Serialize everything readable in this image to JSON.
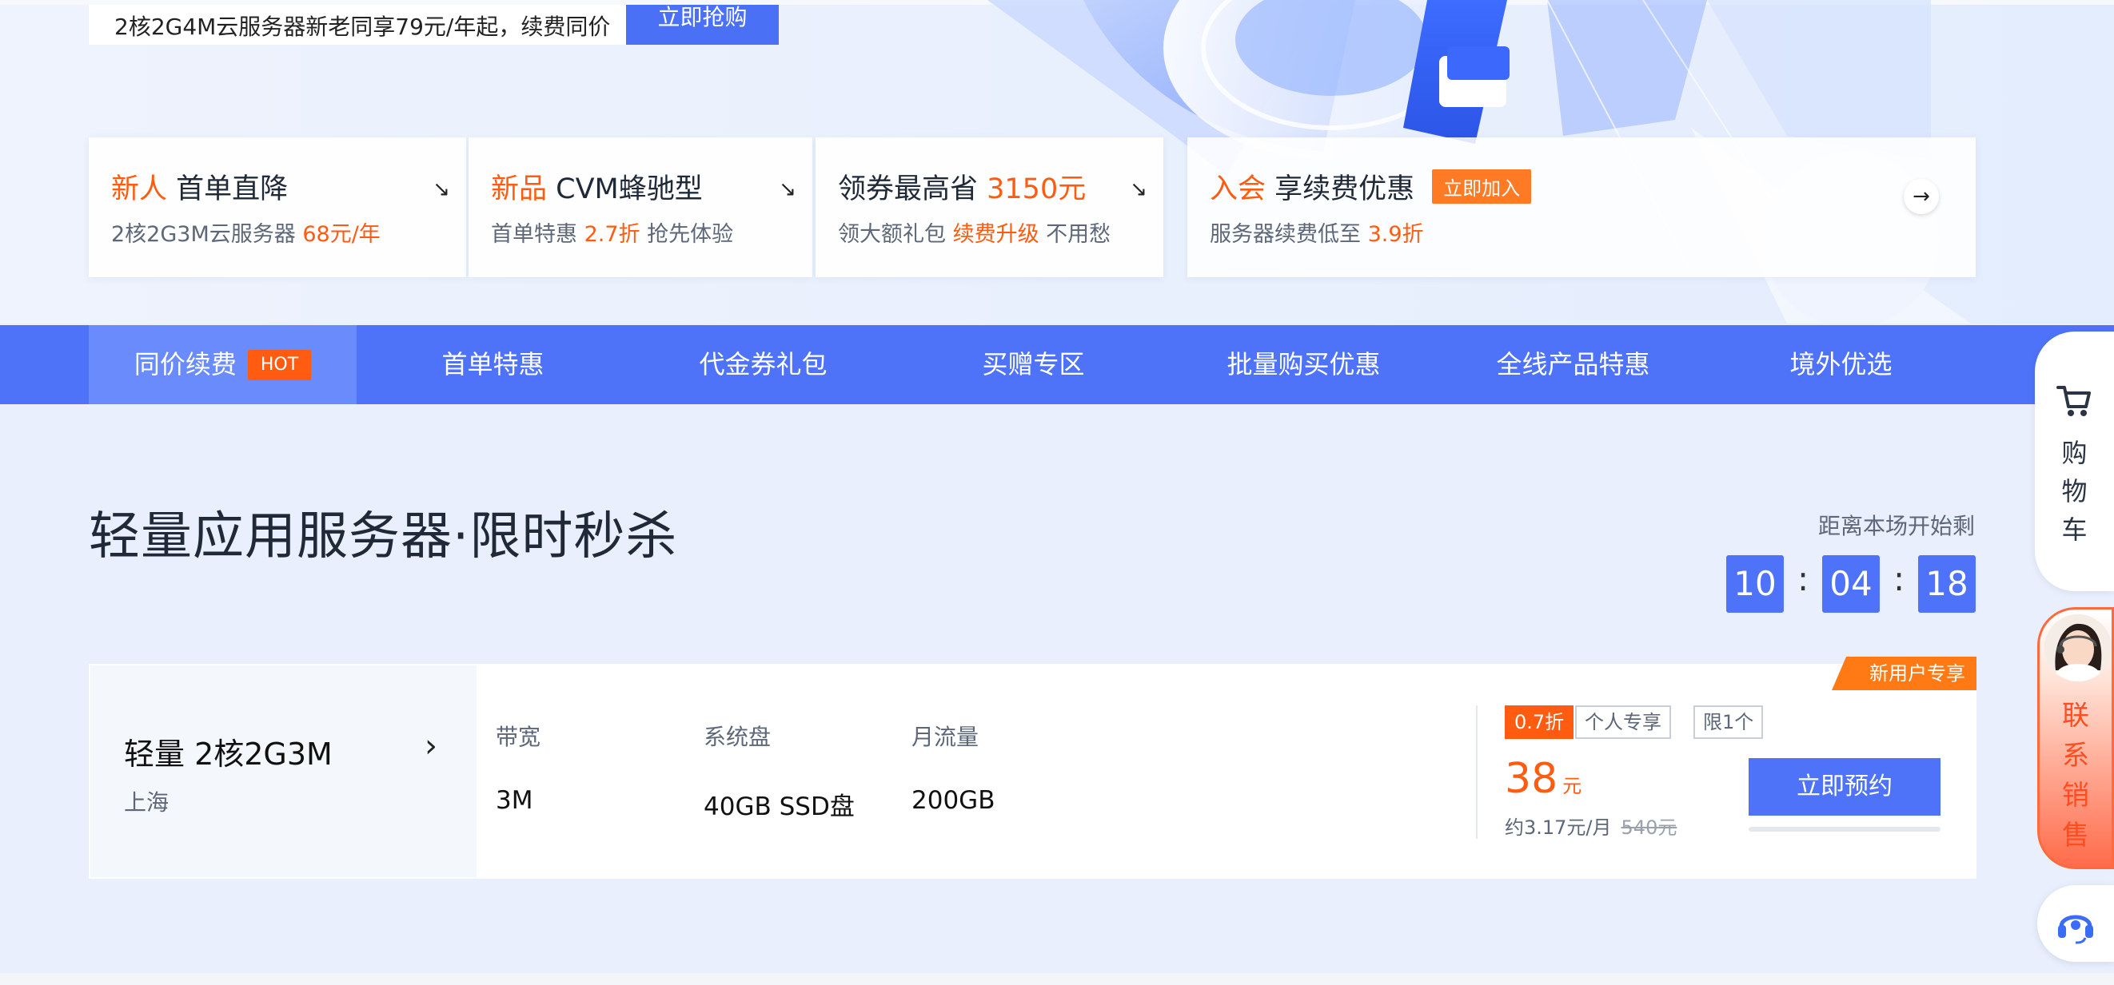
{
  "search": {
    "text": "2核2G4M云服务器新老同享79元/年起，续费同价",
    "button": "立即抢购"
  },
  "promos": [
    {
      "title_hl": "新人",
      "title": " 首单直降",
      "sub": "2核2G3M云服务器 ",
      "sub_hl": "68元/年",
      "sub_tail": "",
      "arrow": "↘"
    },
    {
      "title_hl": "新品",
      "title": " CVM蜂驰型",
      "sub": "首单特惠 ",
      "sub_hl": "2.7折",
      "sub_tail": " 抢先体验",
      "arrow": "↘"
    },
    {
      "title_pre": "领券最高省 ",
      "title_hl": "3150元",
      "sub": "领大额礼包 ",
      "sub_hl": "续费升级",
      "sub_tail": " 不用愁",
      "arrow": "↘"
    },
    {
      "title_hl": "入会",
      "title": " 享续费优惠",
      "badge": "立即加入",
      "sub": "服务器续费低至 ",
      "sub_hl": "3.9折",
      "arrow": "→"
    }
  ],
  "nav": {
    "items": [
      "同价续费",
      "首单特惠",
      "代金券礼包",
      "买赠专区",
      "批量购买优惠",
      "全线产品特惠",
      "境外优选"
    ],
    "hot_badge": "HOT"
  },
  "section": {
    "title": "轻量应用服务器·限时秒杀"
  },
  "countdown": {
    "label": "距离本场开始剩",
    "hours": "10",
    "minutes": "04",
    "seconds": "18",
    "sep": ":"
  },
  "product": {
    "name": "轻量 2核2G3M",
    "chevron": "›",
    "region": "上海",
    "specs": [
      {
        "label": "带宽",
        "value": "3M"
      },
      {
        "label": "系统盘",
        "value": "40GB SSD盘"
      },
      {
        "label": "月流量",
        "value": "200GB"
      }
    ],
    "tags": [
      "0.7折",
      "个人专享",
      "限1个"
    ],
    "price": "38",
    "price_unit": "元",
    "monthly": "约3.17元/月",
    "original": "540元",
    "button": "立即预约",
    "ribbon": "新用户专享"
  },
  "sidebar": {
    "cart": "购\n物\n车",
    "sales": "联\n系\n销\n售"
  },
  "colors": {
    "primary": "#4e73f8",
    "accent": "#ff5b11",
    "nav_active": "#6a8bfb"
  }
}
